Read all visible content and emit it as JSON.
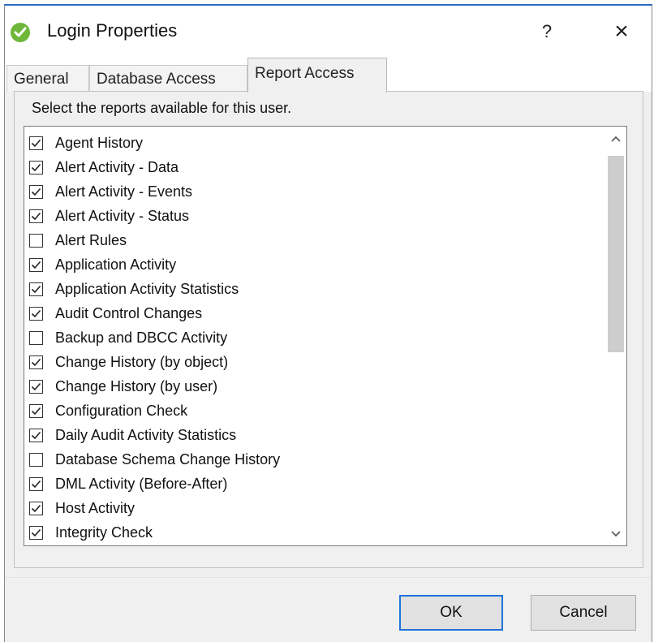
{
  "window": {
    "title": "Login Properties",
    "help_label": "?",
    "close_label": "×"
  },
  "tabs": [
    {
      "label": "General",
      "active": false
    },
    {
      "label": "Database Access",
      "active": false
    },
    {
      "label": "Report Access",
      "active": true
    }
  ],
  "report_access": {
    "instructions": "Select the reports available for this user.",
    "reports": [
      {
        "label": "Agent History",
        "checked": true
      },
      {
        "label": "Alert Activity - Data",
        "checked": true
      },
      {
        "label": "Alert Activity - Events",
        "checked": true
      },
      {
        "label": "Alert Activity - Status",
        "checked": true
      },
      {
        "label": "Alert Rules",
        "checked": false
      },
      {
        "label": "Application Activity",
        "checked": true
      },
      {
        "label": "Application Activity Statistics",
        "checked": true
      },
      {
        "label": "Audit Control Changes",
        "checked": true
      },
      {
        "label": "Backup and DBCC Activity",
        "checked": false
      },
      {
        "label": "Change History (by object)",
        "checked": true
      },
      {
        "label": "Change History (by user)",
        "checked": true
      },
      {
        "label": "Configuration Check",
        "checked": true
      },
      {
        "label": "Daily Audit Activity Statistics",
        "checked": true
      },
      {
        "label": "Database Schema Change History",
        "checked": false
      },
      {
        "label": "DML Activity (Before-After)",
        "checked": true
      },
      {
        "label": "Host Activity",
        "checked": true
      },
      {
        "label": "Integrity Check",
        "checked": true
      }
    ]
  },
  "buttons": {
    "ok_label": "OK",
    "cancel_label": "Cancel"
  },
  "colors": {
    "accent": "#1e74d8",
    "app_icon": "#6fb73b"
  },
  "icons": {
    "app": "green-check-circle-icon",
    "scroll_up": "chevron-up-icon",
    "scroll_down": "chevron-down-icon"
  }
}
